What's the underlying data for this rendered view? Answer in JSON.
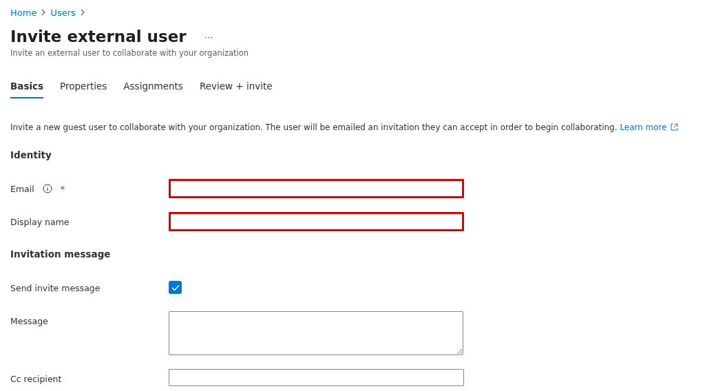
{
  "breadcrumb": [
    "Home",
    "Users"
  ],
  "page": {
    "title": "Invite external user",
    "more": "···",
    "subtitle": "Invite an external user to collaborate with your organization"
  },
  "tabs": [
    {
      "label": "Basics",
      "selected": true
    },
    {
      "label": "Properties",
      "selected": false
    },
    {
      "label": "Assignments",
      "selected": false
    },
    {
      "label": "Review + invite",
      "selected": false
    }
  ],
  "description": {
    "text": "Invite a new guest user to collaborate with your organization. The user will be emailed an invitation they can accept in order to begin collaborating.",
    "link": "Learn more"
  },
  "sections": [
    {
      "heading": "Identity",
      "fields": [
        {
          "kind": "text",
          "label": "Email",
          "info": true,
          "required": "*",
          "highlighted": true
        },
        {
          "kind": "text",
          "label": "Display name",
          "highlighted": true
        }
      ]
    },
    {
      "heading": "Invitation message",
      "fields": [
        {
          "kind": "checkbox",
          "label": "Send invite message",
          "checked": true
        },
        {
          "kind": "textarea",
          "label": "Message"
        },
        {
          "kind": "text",
          "label": "Cc recipient",
          "highlighted": false
        }
      ]
    }
  ]
}
